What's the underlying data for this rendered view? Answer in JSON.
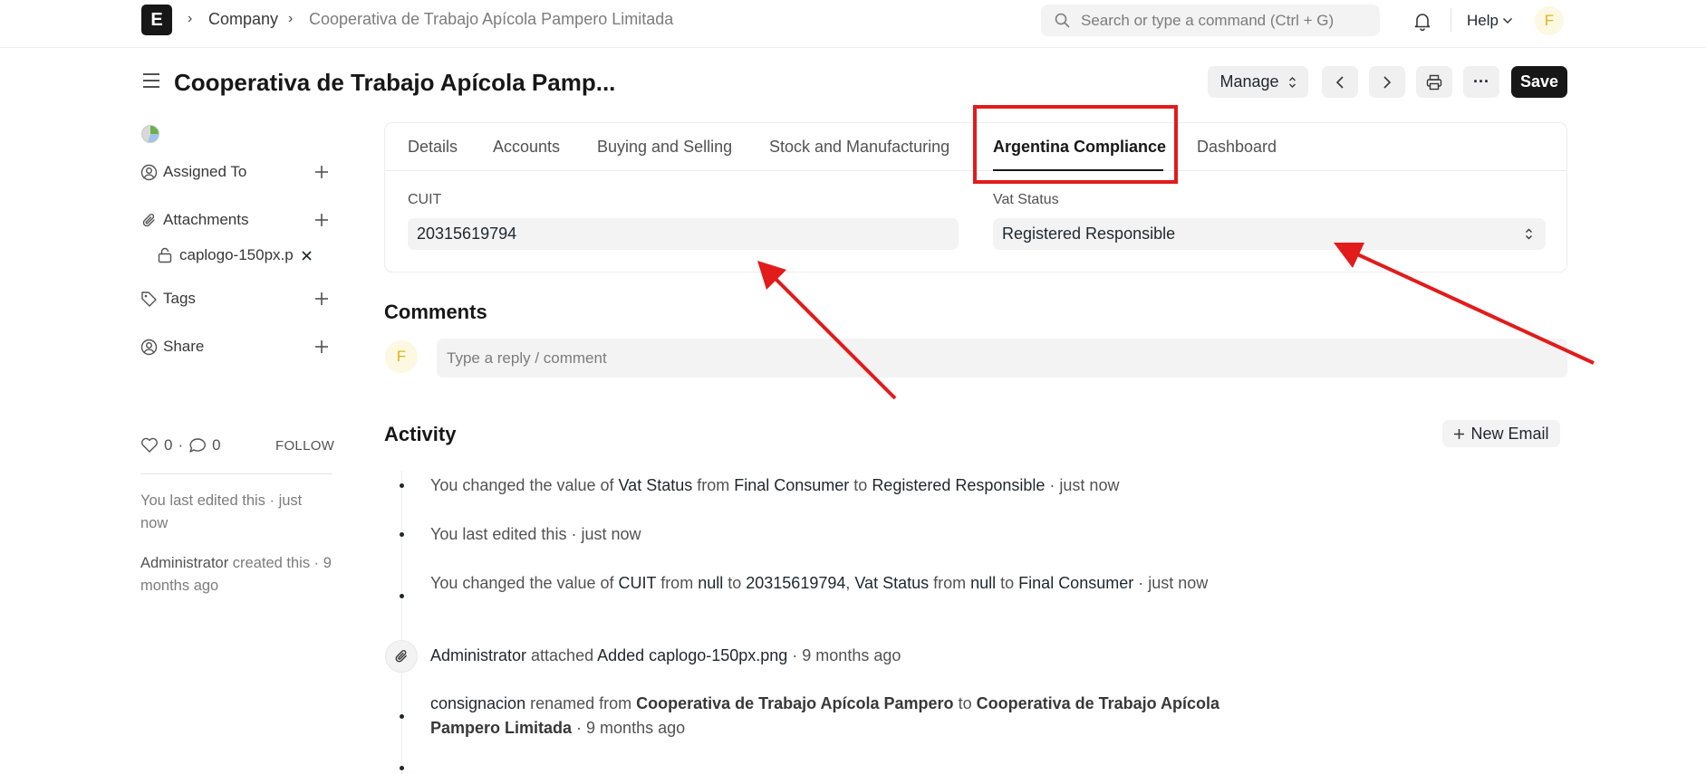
{
  "navbar": {
    "logo": "E",
    "breadcrumb": [
      "Company",
      "Cooperativa de Trabajo Apícola Pampero Limitada"
    ],
    "search_placeholder": "Search or type a command (Ctrl + G)",
    "help_label": "Help",
    "avatar_initial": "F"
  },
  "page": {
    "title": "Cooperativa de Trabajo Apícola Pamp...",
    "manage_label": "Manage",
    "save_label": "Save",
    "more_label": "···"
  },
  "sidebar": {
    "assigned_to": "Assigned To",
    "attachments": "Attachments",
    "attachment_file": "caplogo-150px.p",
    "tags": "Tags",
    "share": "Share",
    "likes_count": "0",
    "comments_count": "0",
    "follow_label": "FOLLOW",
    "last_edited": "You last edited this · just now",
    "created_by": "Administrator",
    "created_text": " created this · 9 months ago"
  },
  "tabs": [
    "Details",
    "Accounts",
    "Buying and Selling",
    "Stock and Manufacturing",
    "Argentina Compliance",
    "Dashboard"
  ],
  "active_tab": "Argentina Compliance",
  "form": {
    "cuit_label": "CUIT",
    "cuit_value": "20315619794",
    "vat_label": "Vat Status",
    "vat_value": "Registered Responsible"
  },
  "comments": {
    "title": "Comments",
    "avatar_initial": "F",
    "placeholder": "Type a reply / comment"
  },
  "activity": {
    "title": "Activity",
    "new_email_label": "New Email",
    "items": [
      {
        "a": "You changed the value of ",
        "b": "Vat Status",
        "c": " from ",
        "d": "Final Consumer",
        "e": " to ",
        "f": "Registered Responsible",
        "g": " · just now"
      },
      {
        "text": "You last edited this · just now"
      },
      {
        "a": "You changed the value of ",
        "b": "CUIT",
        "c": " from ",
        "d": "null",
        "e": " to ",
        "f": "20315619794",
        "g": ", ",
        "h": "Vat Status",
        "i": " from ",
        "j": "null",
        "k": " to ",
        "l": "Final Consumer",
        "m": " · just now"
      },
      {
        "a": "Administrator",
        "b": " attached ",
        "c": "Added caplogo-150px.png",
        "d": " · 9 months ago"
      },
      {
        "a": "consignacion",
        "b": " renamed from ",
        "c": "Cooperativa de Trabajo Apícola Pampero",
        "d": " to ",
        "e": "Cooperativa de Trabajo Apícola Pampero Limitada",
        "f": " · 9 months ago"
      }
    ]
  },
  "colors": {
    "annotation": "#e21b1b",
    "save_bg": "#171717",
    "avatar_bg": "#fdf8e2",
    "avatar_fg": "#e0b21a"
  }
}
